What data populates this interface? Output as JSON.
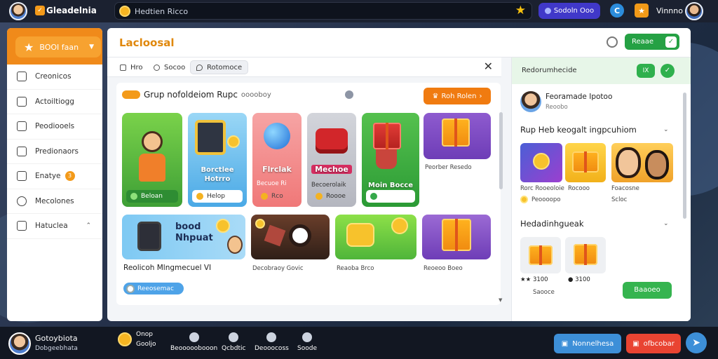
{
  "topbar": {
    "brand": "Gleadelnia",
    "search_text": "Hedtien Ricco",
    "pill_button": "Sodoln Ooo",
    "user_name": "Vinnno"
  },
  "sidebar": {
    "header_label": "BOOI faan",
    "items": [
      {
        "label": "Creonicos",
        "icon": "folder-icon"
      },
      {
        "label": "Actoiltiogg",
        "icon": "edit-icon"
      },
      {
        "label": "Peodiooels",
        "icon": "document-icon"
      },
      {
        "label": "Predionaors",
        "icon": "list-icon"
      },
      {
        "label": "Enatye",
        "icon": "box-icon",
        "badge": "3"
      },
      {
        "label": "Mecolones",
        "icon": "globe-icon"
      },
      {
        "label": "Hatuclea",
        "icon": "chart-icon"
      }
    ]
  },
  "main": {
    "title": "Lacloosal",
    "header_button": "Reaae",
    "tabs": [
      {
        "label": "Hro",
        "icon": "info-icon"
      },
      {
        "label": "Socoo",
        "icon": "settings-icon"
      },
      {
        "label": "Rotomoce",
        "icon": "location-icon"
      }
    ],
    "section": {
      "title": "Grup nofoldeiom Rupc",
      "subtitle": "ooooboy",
      "action_button": "Roh Rolen"
    },
    "cards_row1": [
      {
        "caption": "Beloan"
      },
      {
        "label": "Borctlee Hotrro",
        "caption": "Helop"
      },
      {
        "label": "Flrclak",
        "sub": "Becuoe Ri",
        "caption": "Rco"
      },
      {
        "label": "Mechoe",
        "sub": "Becoerolaik",
        "caption": "Roooe"
      },
      {
        "label": "Moin Bocce",
        "caption": ""
      },
      {
        "sub": "Peorber Resedo"
      }
    ],
    "cards_row2": [
      {
        "title": "bood Nhpuat",
        "sub": "Reolicoh Mlngmecuel VI",
        "caption": "Reeosemac"
      },
      {
        "sub": "Decobraoy Govic"
      },
      {
        "sub": "Reaoba Brco"
      },
      {
        "sub": "Reoeoo Boeo"
      }
    ]
  },
  "rpanel": {
    "header": "Redorumhecide",
    "header_badge": "IX",
    "profile_name": "Feoramade Ipotoo",
    "profile_sub": "Reoobo",
    "section1_title": "Rup Heb keogalt ingpcuhiom",
    "items1": [
      {
        "label": "Rorc Rooeoloie"
      },
      {
        "label": "Rocooo"
      },
      {
        "label": "Foacosne"
      }
    ],
    "items1_sub": [
      "Peoooopo",
      "Scloc"
    ],
    "section2_title": "Hedadinhgueak",
    "items2": [
      {
        "stars": 2,
        "price": "3100"
      },
      {
        "stars": 2,
        "price": "3100"
      }
    ],
    "items2_sub": "Saooce",
    "action_button": "Baaoeo"
  },
  "bottombar": {
    "name": "Gotoybiota",
    "sub": "Dobgeebhata",
    "nav": [
      {
        "label": "Onop",
        "sub": "Gooljo"
      },
      {
        "label": "Beooooobooon"
      },
      {
        "label": "Qcbdtic"
      },
      {
        "label": "Deooocoss"
      },
      {
        "label": "Soode"
      }
    ],
    "btn_blue": "Nonnelhesa",
    "btn_red": "ofbcobar"
  }
}
